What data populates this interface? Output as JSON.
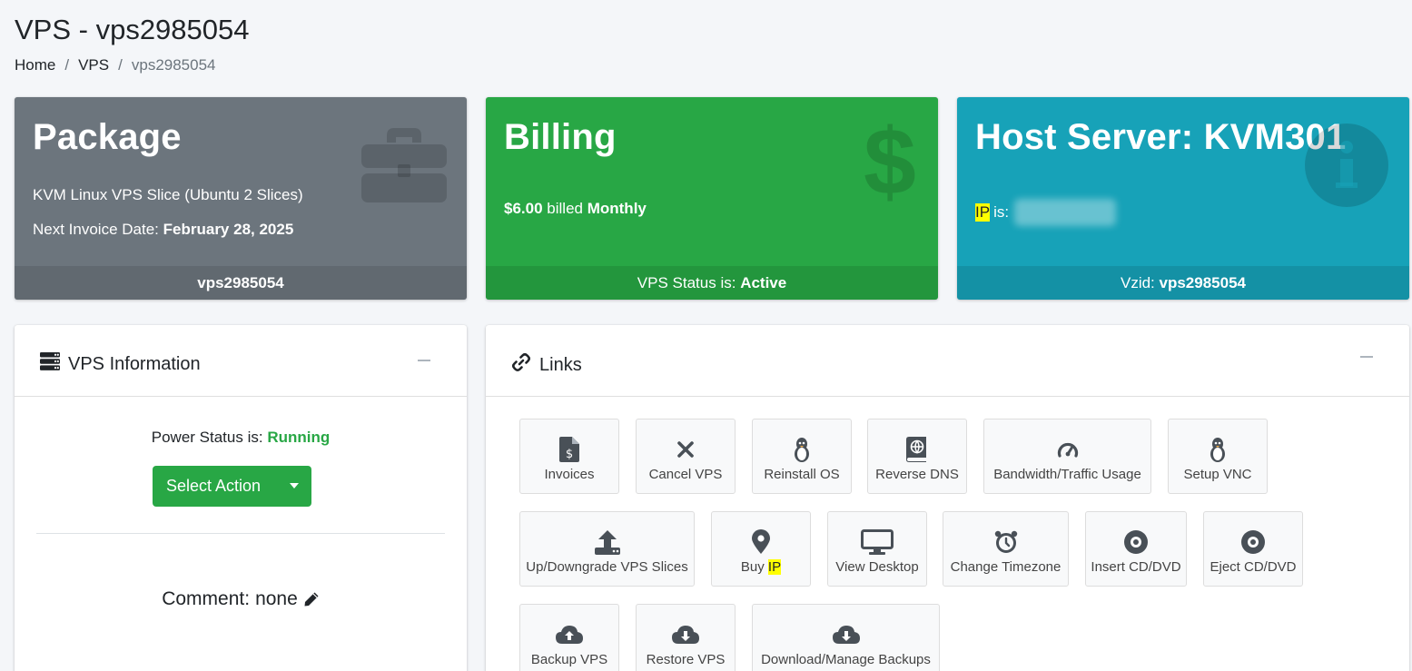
{
  "page": {
    "title": "VPS - vps2985054"
  },
  "breadcrumb": {
    "home": "Home",
    "vps": "VPS",
    "current": "vps2985054",
    "separator": "/"
  },
  "package_box": {
    "title": "Package",
    "product": "KVM Linux VPS Slice (Ubuntu 2 Slices)",
    "invoice_label": "Next Invoice Date:",
    "invoice_date": "February 28, 2025",
    "footer": "vps2985054",
    "icon": "briefcase-icon",
    "color": "#6c757d"
  },
  "billing_box": {
    "title": "Billing",
    "amount": "$6.00",
    "billed_text": "billed",
    "period": "Monthly",
    "footer_label": "VPS Status is:",
    "footer_value": "Active",
    "icon": "dollar-icon",
    "color": "#28a745"
  },
  "host_box": {
    "title": "Host Server: KVM301",
    "ip_label": "IP",
    "ip_suffix": "is:",
    "footer_label": "Vzid:",
    "footer_value": "vps2985054",
    "icon": "info-circle-icon",
    "color": "#17a2b8"
  },
  "vps_info": {
    "title": "VPS Information",
    "power_label": "Power Status is:",
    "power_value": "Running",
    "action_button": "Select Action",
    "comment_label": "Comment:",
    "comment_value": "none"
  },
  "links": {
    "title": "Links",
    "items": [
      {
        "label": "Invoices",
        "icon": "invoice-icon"
      },
      {
        "label": "Cancel VPS",
        "icon": "x-icon"
      },
      {
        "label": "Reinstall OS",
        "icon": "linux-icon"
      },
      {
        "label": "Reverse DNS",
        "icon": "dns-book-icon"
      },
      {
        "label": "Bandwidth/Traffic Usage",
        "icon": "gauge-icon"
      },
      {
        "label": "Setup VNC",
        "icon": "linux-icon"
      },
      {
        "label": "Up/Downgrade VPS Slices",
        "icon": "upload-icon"
      },
      {
        "label_pre": "Buy ",
        "label_hl": "IP",
        "icon": "map-pin-icon"
      },
      {
        "label": "View Desktop",
        "icon": "desktop-icon"
      },
      {
        "label": "Change Timezone",
        "icon": "alarm-clock-icon"
      },
      {
        "label": "Insert CD/DVD",
        "icon": "disc-icon"
      },
      {
        "label": "Eject CD/DVD",
        "icon": "disc-icon"
      },
      {
        "label": "Backup VPS",
        "icon": "cloud-upload-icon"
      },
      {
        "label": "Restore VPS",
        "icon": "cloud-download-icon"
      },
      {
        "label": "Download/Manage Backups",
        "icon": "cloud-download-icon"
      }
    ]
  }
}
